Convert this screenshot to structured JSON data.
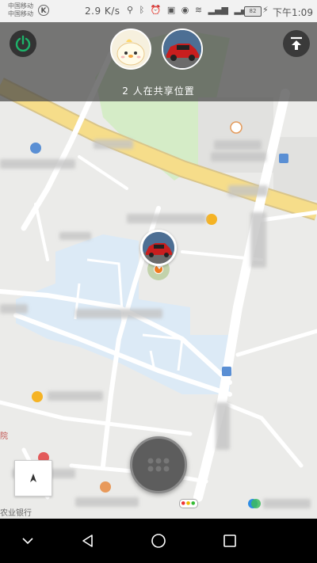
{
  "status_bar": {
    "carrier_1": "中国移动",
    "carrier_2": "中国移动",
    "carrier_badge": "K",
    "net_speed": "2.9 K/s",
    "battery": "82",
    "time": "下午1:09"
  },
  "share_panel": {
    "shared_count_text": "2 人在共享位置",
    "avatars": [
      {
        "name": "chick-avatar"
      },
      {
        "name": "red-car-avatar"
      }
    ]
  },
  "map_labels": {
    "bank": "农业银行",
    "partial_left_1": "院"
  },
  "colors": {
    "accent_green": "#1db36a",
    "location_dot": "#f07a1e",
    "road_yellow": "#f6dd8a",
    "park_green": "#d5ecc7",
    "campus_blue": "#dceaf6"
  },
  "icons": {
    "power": "power-icon",
    "upload": "upload-top-icon",
    "compass": "compass-icon",
    "menu": "grid-dots-icon",
    "nav_back": "back-triangle-icon",
    "nav_home": "home-circle-icon",
    "nav_recent": "recent-square-icon",
    "nav_down": "chevron-down-icon"
  }
}
